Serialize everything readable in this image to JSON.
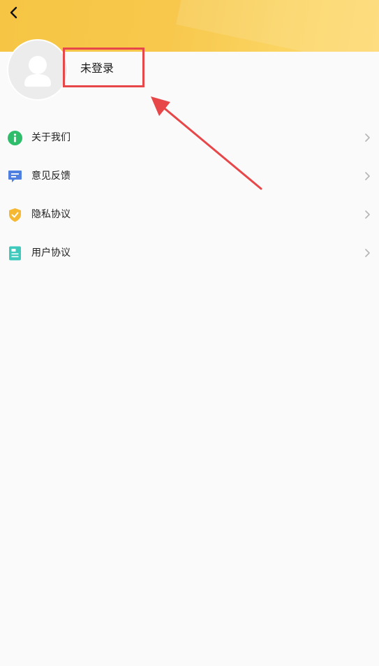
{
  "header": {
    "back_icon": "chevron-left-icon"
  },
  "profile": {
    "login_status": "未登录",
    "avatar_icon": "user-placeholder-icon",
    "highlight_color": "#e8474a"
  },
  "menu": {
    "items": [
      {
        "label": "关于我们",
        "icon": "info-icon",
        "color": "#2ebd6b"
      },
      {
        "label": "意见反馈",
        "icon": "feedback-icon",
        "color": "#4f7fe0"
      },
      {
        "label": "隐私协议",
        "icon": "shield-icon",
        "color": "#f6b731"
      },
      {
        "label": "用户协议",
        "icon": "document-icon",
        "color": "#3ec9bd"
      }
    ]
  },
  "colors": {
    "header": "#f7c84c",
    "background": "#fafafa",
    "annotation_red": "#e8474a"
  }
}
